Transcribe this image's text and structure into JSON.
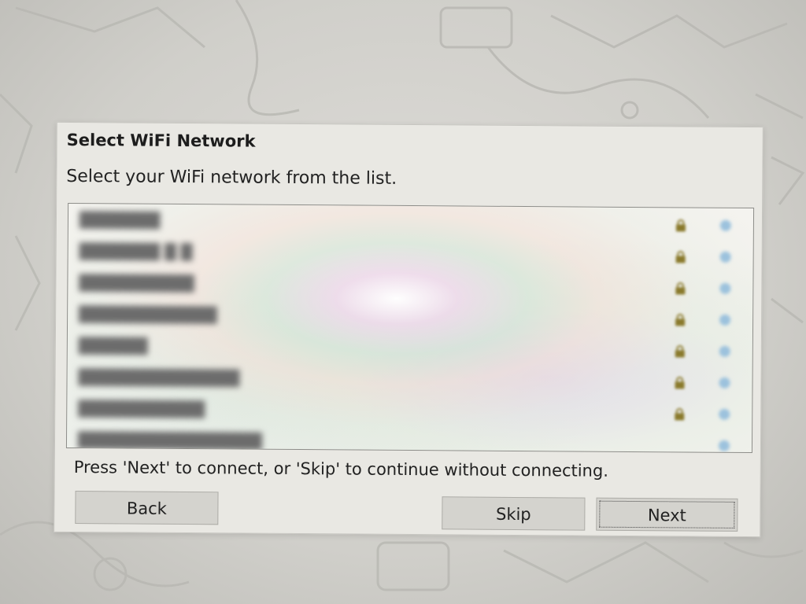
{
  "dialog": {
    "title": "Select WiFi Network",
    "description": "Select your WiFi network from the list.",
    "hint": "Press 'Next' to connect, or 'Skip' to continue without connecting."
  },
  "network_list": {
    "rows": [
      {
        "name": "███████",
        "secured": true,
        "signal_icon": "wifi-signal-icon"
      },
      {
        "name": "███████ █ █",
        "secured": true,
        "signal_icon": "wifi-signal-icon"
      },
      {
        "name": "██████████",
        "secured": true,
        "signal_icon": "wifi-signal-icon"
      },
      {
        "name": "████████████",
        "secured": true,
        "signal_icon": "wifi-signal-icon"
      },
      {
        "name": "██████",
        "secured": true,
        "signal_icon": "wifi-signal-icon"
      },
      {
        "name": "██████████████",
        "secured": true,
        "signal_icon": "wifi-signal-icon"
      },
      {
        "name": "███████████",
        "secured": true,
        "signal_icon": "wifi-signal-icon"
      },
      {
        "name": "████████████████",
        "secured": false,
        "signal_icon": "wifi-signal-icon"
      }
    ]
  },
  "buttons": {
    "back": "Back",
    "skip": "Skip",
    "next": "Next"
  },
  "colors": {
    "dialog_bg": "#e9e8e3",
    "list_bg": "#f4f3ef",
    "lock": "#8a7a2c",
    "signal": "#9cc2dd"
  },
  "icons": {
    "lock": "lock-icon",
    "signal": "wifi-signal-icon"
  }
}
